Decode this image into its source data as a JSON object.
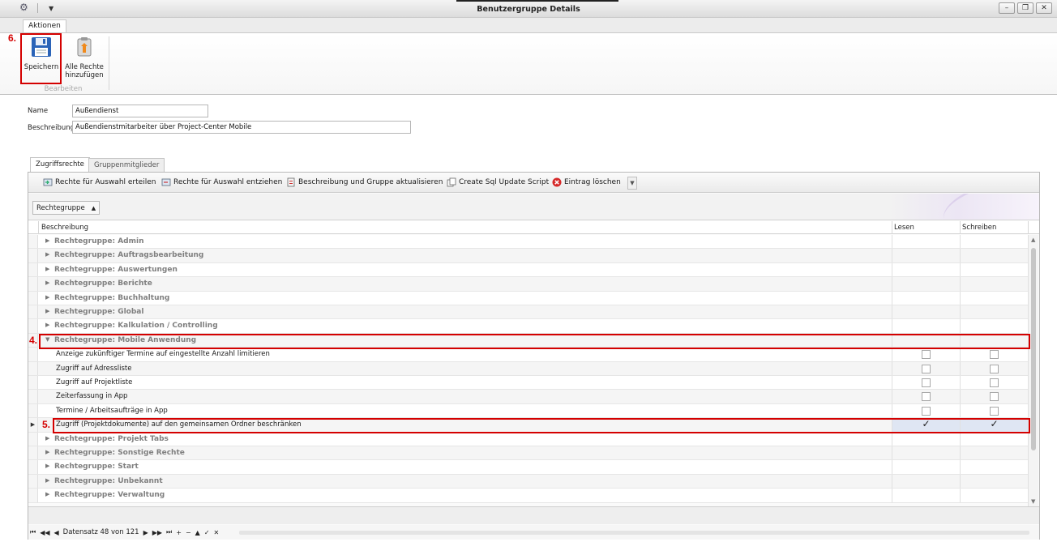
{
  "window": {
    "title": "Benutzergruppe Details",
    "buttons": {
      "minimize": "–",
      "restore": "❐",
      "close": "✕"
    }
  },
  "ribbon": {
    "tab": "Aktionen",
    "save_label": "Speichern",
    "add_all_label_line1": "Alle Rechte",
    "add_all_label_line2": "hinzufügen",
    "group_label": "Bearbeiten"
  },
  "annotations": {
    "step4": "4.",
    "step5": "5.",
    "step6": "6."
  },
  "form": {
    "name_label": "Name",
    "name_value": "Außendienst",
    "desc_label": "Beschreibung",
    "desc_value": "Außendienstmitarbeiter über Project-Center Mobile"
  },
  "tabs": {
    "rights": "Zugriffsrechte",
    "members": "Gruppenmitglieder"
  },
  "toolbar": {
    "grant": "Rechte für Auswahl erteilen",
    "revoke": "Rechte für Auswahl entziehen",
    "update": "Beschreibung und Gruppe aktualisieren",
    "sql": "Create Sql Update Script",
    "delete": "Eintrag löschen"
  },
  "group_by": {
    "chip_label": "Rechtegruppe",
    "chip_sort": "▲"
  },
  "grid": {
    "columns": {
      "description": "Beschreibung",
      "read": "Lesen",
      "write": "Schreiben"
    },
    "rows": [
      {
        "type": "group",
        "label": "Rechtegruppe: Admin",
        "expanded": false
      },
      {
        "type": "group",
        "label": "Rechtegruppe: Auftragsbearbeitung",
        "expanded": false
      },
      {
        "type": "group",
        "label": "Rechtegruppe: Auswertungen",
        "expanded": false
      },
      {
        "type": "group",
        "label": "Rechtegruppe: Berichte",
        "expanded": false
      },
      {
        "type": "group",
        "label": "Rechtegruppe: Buchhaltung",
        "expanded": false
      },
      {
        "type": "group",
        "label": "Rechtegruppe: Global",
        "expanded": false
      },
      {
        "type": "group",
        "label": "Rechtegruppe: Kalkulation / Controlling",
        "expanded": false
      },
      {
        "type": "group",
        "label": "Rechtegruppe: Mobile Anwendung",
        "expanded": true
      },
      {
        "type": "item",
        "label": "Anzeige zukünftiger Termine auf eingestellte Anzahl limitieren",
        "read": false,
        "write": false
      },
      {
        "type": "item",
        "label": "Zugriff auf Adressliste",
        "read": false,
        "write": false
      },
      {
        "type": "item",
        "label": "Zugriff auf Projektliste",
        "read": false,
        "write": false
      },
      {
        "type": "item",
        "label": "Zeiterfassung in App",
        "read": false,
        "write": false
      },
      {
        "type": "item",
        "label": "Termine / Arbeitsaufträge in App",
        "read": false,
        "write": false
      },
      {
        "type": "item",
        "label": "Zugriff (Projektdokumente) auf den gemeinsamen Ordner beschränken",
        "read": true,
        "write": true,
        "selected": true
      },
      {
        "type": "group",
        "label": "Rechtegruppe: Projekt Tabs",
        "expanded": false
      },
      {
        "type": "group",
        "label": "Rechtegruppe: Sonstige Rechte",
        "expanded": false
      },
      {
        "type": "group",
        "label": "Rechtegruppe: Start",
        "expanded": false
      },
      {
        "type": "group",
        "label": "Rechtegruppe: Unbekannt",
        "expanded": false
      },
      {
        "type": "group",
        "label": "Rechtegruppe: Verwaltung",
        "expanded": false
      }
    ]
  },
  "navigator": {
    "record_text": "Datensatz 48 von 121"
  },
  "colors": {
    "annotation": "#d40000",
    "group_text": "#7f7f7f",
    "selection": "#dfe6f3"
  }
}
